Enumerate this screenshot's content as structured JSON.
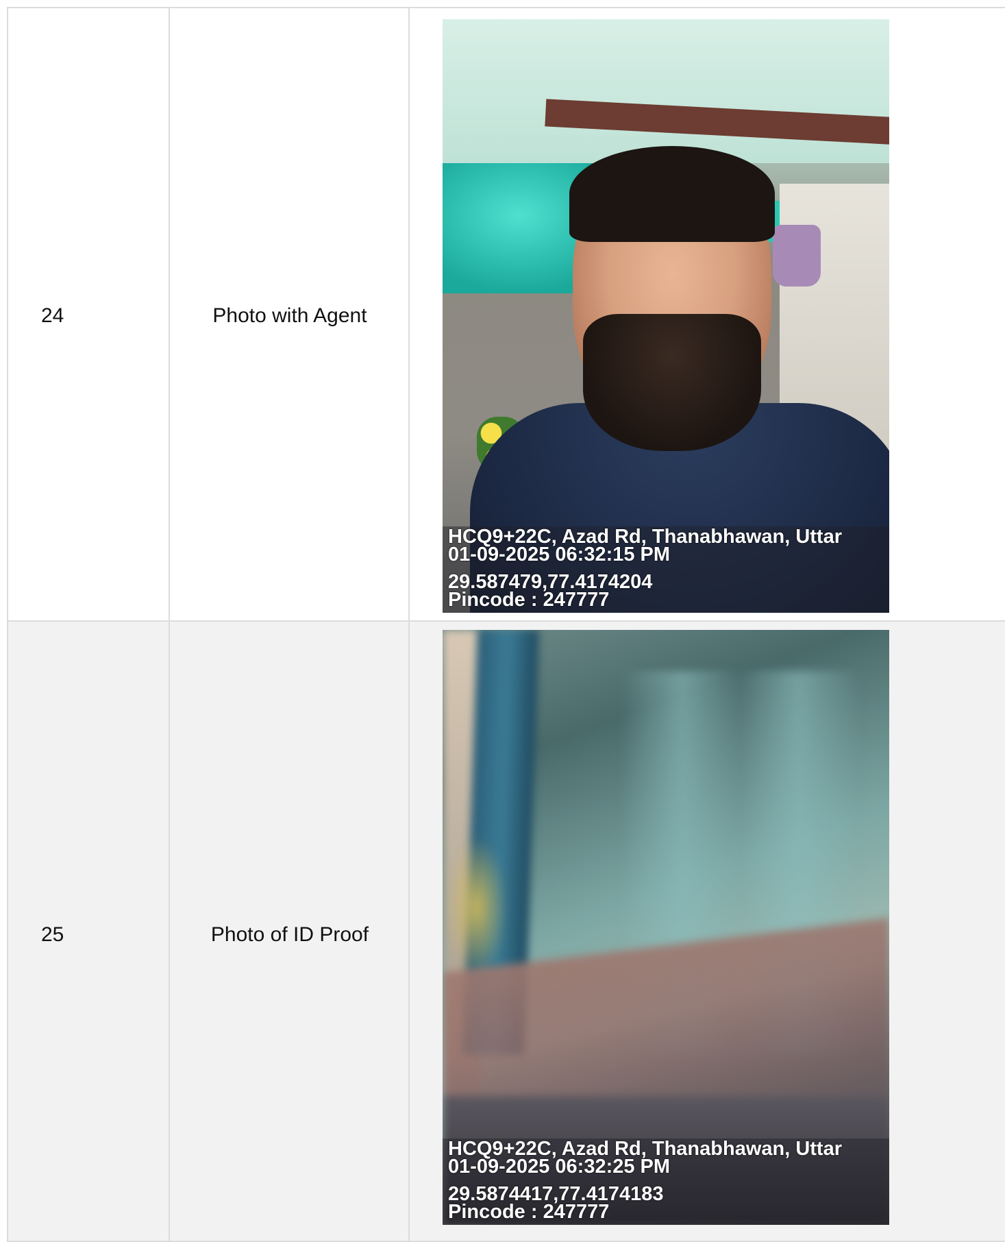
{
  "rows": [
    {
      "number": "24",
      "label": "Photo with Agent",
      "photo": {
        "address": "HCQ9+22C, Azad Rd, Thanabhawan, Uttar",
        "datetime": "01-09-2025 06:32:15 PM",
        "coords": "29.587479,77.4174204",
        "pincode": "Pincode : 247777"
      }
    },
    {
      "number": "25",
      "label": "Photo of ID Proof",
      "photo": {
        "address": "HCQ9+22C, Azad Rd, Thanabhawan, Uttar",
        "datetime": "01-09-2025 06:32:25 PM",
        "coords": "29.5874417,77.4174183",
        "pincode": "Pincode : 247777"
      }
    }
  ],
  "colors": {
    "border": "#dcdcdc",
    "row_alt": "#f2f2f2"
  }
}
